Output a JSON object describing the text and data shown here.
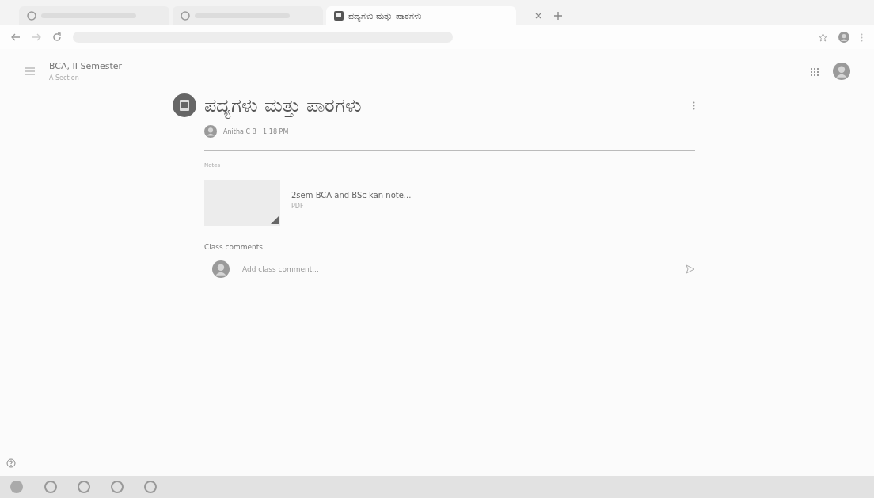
{
  "browser": {
    "tabs": [
      {
        "selected": false
      },
      {
        "selected": false
      },
      {
        "title": "ಪದ್ಯಗಳು ಮತ್ತು ಪಾರಗಳು",
        "selected": true
      }
    ]
  },
  "header": {
    "class_name": "BCA, II Semester",
    "section": "A Section"
  },
  "post": {
    "title": "ಪದ್ಯಗಳು ಮತ್ತು ಪಾರಗಳು",
    "author": "Anitha C B",
    "time": "1:18 PM",
    "notes_label": "Notes",
    "attachment": {
      "name": "2sem BCA and BSc kan note...",
      "type": "PDF"
    },
    "comments_label": "Class comments",
    "comment_placeholder": "Add class comment..."
  }
}
